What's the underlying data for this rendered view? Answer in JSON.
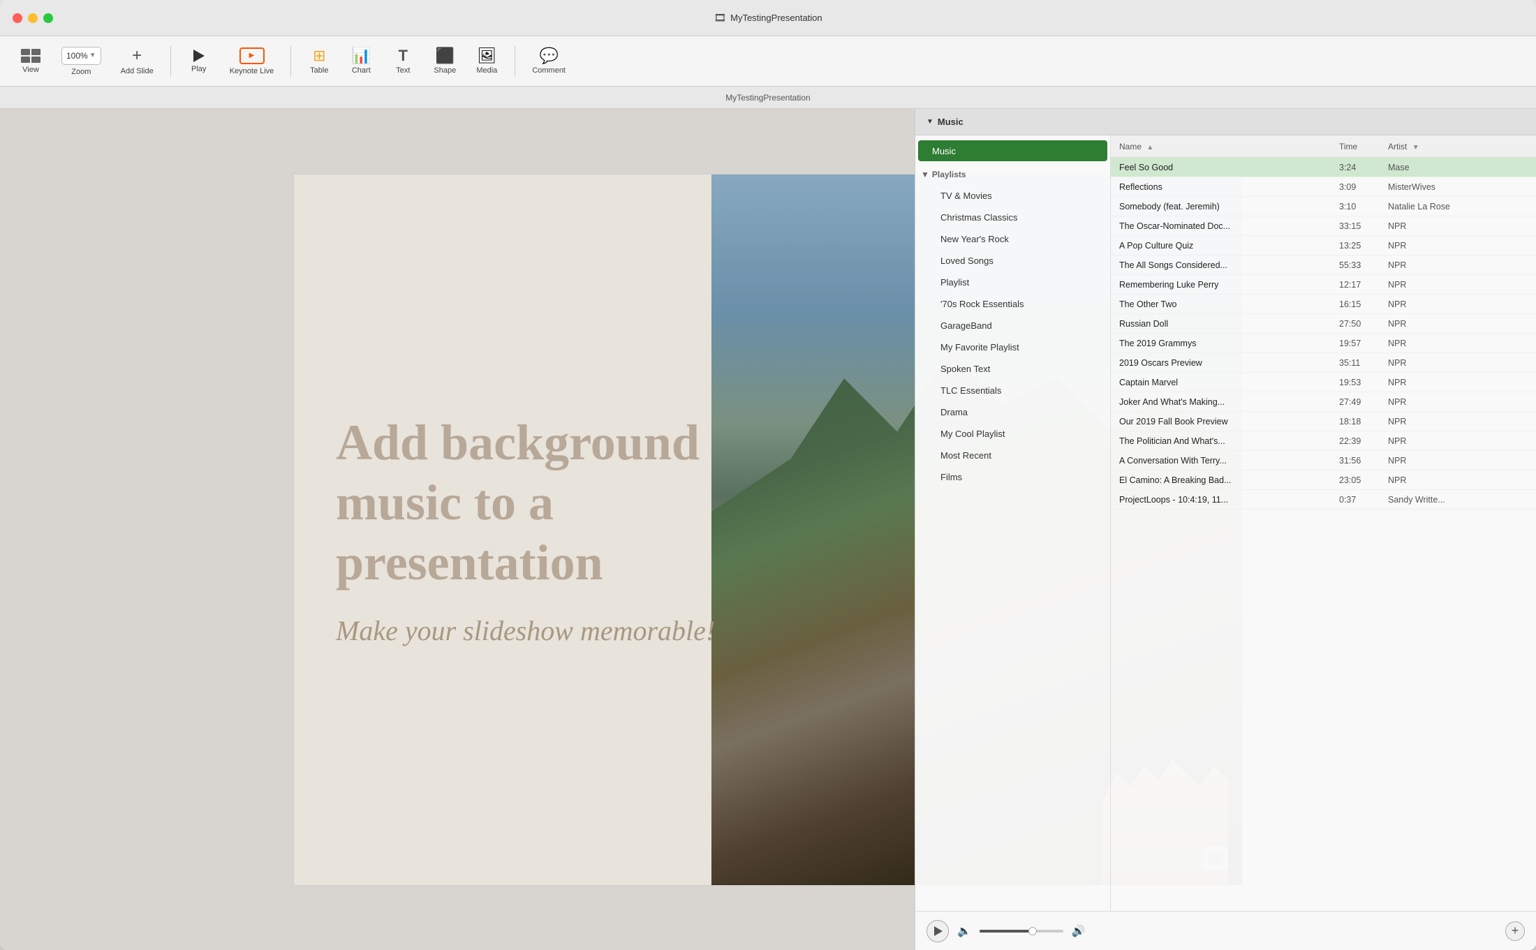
{
  "window": {
    "title": "MyTestingPresentation",
    "title_icon": "🎞"
  },
  "toolbar": {
    "view_label": "View",
    "zoom_label": "Zoom",
    "zoom_value": "100%",
    "add_slide_label": "Add Slide",
    "play_label": "Play",
    "keynote_live_label": "Keynote Live",
    "table_label": "Table",
    "chart_label": "Chart",
    "text_label": "Text",
    "shape_label": "Shape",
    "media_label": "Media",
    "comment_label": "Comment"
  },
  "tabbar": {
    "document_name": "MyTestingPresentation"
  },
  "slide": {
    "main_title": "Add background music to a presentation",
    "subtitle": "Make your slideshow memorable!"
  },
  "music_panel": {
    "header_title": "Music",
    "sidebar": {
      "music_item": "Music",
      "playlists_section": "Playlists",
      "items": [
        {
          "label": "TV & Movies",
          "indent": true
        },
        {
          "label": "Christmas Classics",
          "indent": true
        },
        {
          "label": "New Year's Rock",
          "indent": true
        },
        {
          "label": "Loved Songs",
          "indent": true
        },
        {
          "label": "Playlist",
          "indent": true
        },
        {
          "label": "'70s Rock Essentials",
          "indent": true
        },
        {
          "label": "GarageBand",
          "indent": true
        },
        {
          "label": "My Favorite Playlist",
          "indent": true
        },
        {
          "label": "Spoken Text",
          "indent": true
        },
        {
          "label": "TLC Essentials",
          "indent": true
        },
        {
          "label": "Drama",
          "indent": true
        },
        {
          "label": "My Cool Playlist",
          "indent": true
        },
        {
          "label": "Most Recent",
          "indent": true
        },
        {
          "label": "Films",
          "indent": true
        }
      ]
    },
    "tracklist": {
      "col_name": "Name",
      "col_time": "Time",
      "col_artist": "Artist",
      "tracks": [
        {
          "name": "Feel So Good",
          "time": "3:24",
          "artist": "Mase"
        },
        {
          "name": "Reflections",
          "time": "3:09",
          "artist": "MisterWives"
        },
        {
          "name": "Somebody (feat. Jeremih)",
          "time": "3:10",
          "artist": "Natalie La Rose"
        },
        {
          "name": "The Oscar-Nominated Doc...",
          "time": "33:15",
          "artist": "NPR"
        },
        {
          "name": "A Pop Culture Quiz",
          "time": "13:25",
          "artist": "NPR"
        },
        {
          "name": "The All Songs Considered...",
          "time": "55:33",
          "artist": "NPR"
        },
        {
          "name": "Remembering Luke Perry",
          "time": "12:17",
          "artist": "NPR"
        },
        {
          "name": "The Other Two",
          "time": "16:15",
          "artist": "NPR"
        },
        {
          "name": "Russian Doll",
          "time": "27:50",
          "artist": "NPR"
        },
        {
          "name": "The 2019 Grammys",
          "time": "19:57",
          "artist": "NPR"
        },
        {
          "name": "2019 Oscars Preview",
          "time": "35:11",
          "artist": "NPR"
        },
        {
          "name": "Captain Marvel",
          "time": "19:53",
          "artist": "NPR"
        },
        {
          "name": "Joker And What's Making...",
          "time": "27:49",
          "artist": "NPR"
        },
        {
          "name": "Our 2019 Fall Book Preview",
          "time": "18:18",
          "artist": "NPR"
        },
        {
          "name": "The Politician And What's...",
          "time": "22:39",
          "artist": "NPR"
        },
        {
          "name": "A Conversation With Terry...",
          "time": "31:56",
          "artist": "NPR"
        },
        {
          "name": "El Camino: A Breaking Bad...",
          "time": "23:05",
          "artist": "NPR"
        },
        {
          "name": "ProjectLoops - 10:4:19, 11...",
          "time": "0:37",
          "artist": "Sandy Writte..."
        }
      ]
    },
    "playback": {
      "play_label": "Play",
      "volume_icon": "🔈",
      "speaker_icon": "🔊",
      "add_label": "+"
    }
  }
}
